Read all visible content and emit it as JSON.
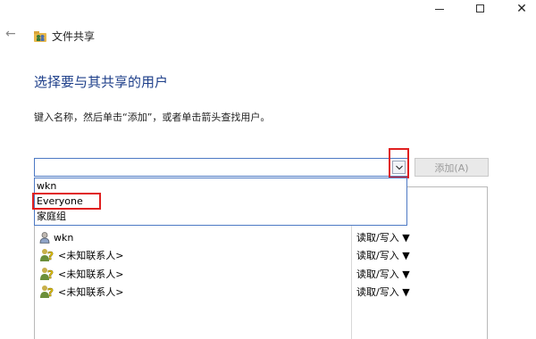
{
  "window": {
    "minimize_glyph": "—",
    "maximize_glyph": "□",
    "close_glyph": "✕",
    "back_glyph": "←",
    "title": "文件共享"
  },
  "page": {
    "heading": "选择要与其共享的用户",
    "instruction": "键入名称，然后单击“添加”，或者单击箭头查找用户。"
  },
  "combo": {
    "value": "",
    "arrow_icon": "chevron-down-icon"
  },
  "add_button": {
    "label": "添加(A)"
  },
  "dropdown": {
    "items": [
      "wkn",
      "Everyone",
      "家庭组"
    ]
  },
  "share_list": {
    "rows": [
      {
        "name": "wkn",
        "permission": "读取/写入 ▼",
        "icon": "user-icon"
      },
      {
        "name": "<未知联系人>",
        "permission": "读取/写入 ▼",
        "icon": "unknown-contact-icon"
      },
      {
        "name": "<未知联系人>",
        "permission": "读取/写入 ▼",
        "icon": "unknown-contact-icon"
      },
      {
        "name": "<未知联系人>",
        "permission": "读取/写入 ▼",
        "icon": "unknown-contact-icon"
      }
    ]
  },
  "colors": {
    "heading": "#1e3f8a",
    "highlight_box": "#e02020",
    "focus_border": "#4d79c4"
  }
}
